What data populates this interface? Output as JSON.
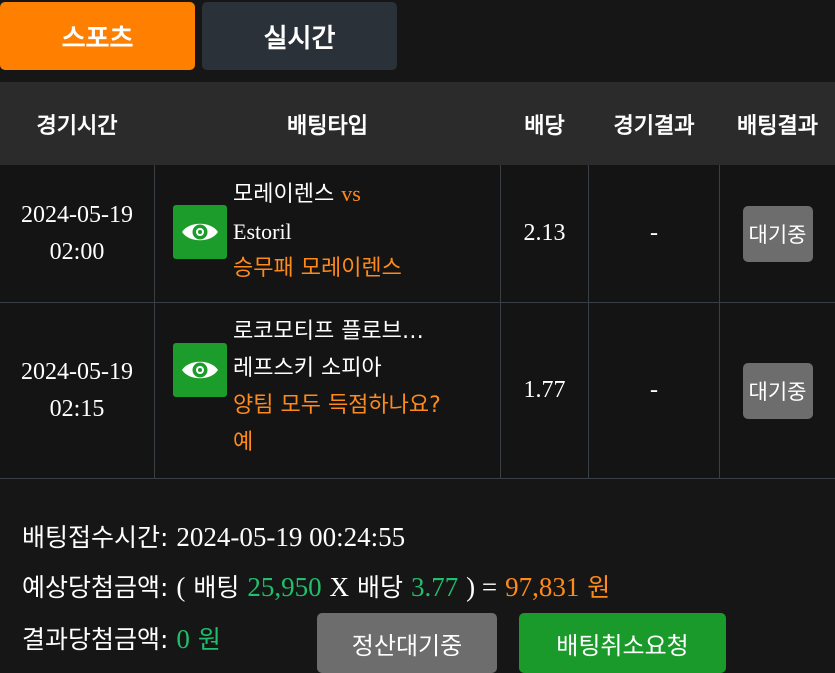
{
  "tabs": {
    "sports": "스포츠",
    "live": "실시간"
  },
  "columns": {
    "time": "경기시간",
    "bet_type": "배팅타입",
    "odds": "배당",
    "match_result": "경기결과",
    "bet_result": "배팅결과"
  },
  "bets": [
    {
      "date": "2024-05-19",
      "time": "02:00",
      "team1": "모레이렌스",
      "vs": "vs",
      "team2": "Estoril",
      "pick": "승무패 모레이렌스",
      "odds": "2.13",
      "result": "-",
      "status": "대기중"
    },
    {
      "date": "2024-05-19",
      "time": "02:15",
      "line1": "로코모티프 플로브…",
      "line2": "레프스키 소피아",
      "pick1": "양팀 모두 득점하나요?",
      "pick2": "예",
      "odds": "1.77",
      "result": "-",
      "status": "대기중"
    }
  ],
  "summary": {
    "received_label": "배팅접수시간:",
    "received_value": "2024-05-19 00:24:55",
    "expected_label": "예상당첨금액:",
    "open_paren": "(",
    "bet_word": "배팅",
    "bet_amount": "25,950",
    "x": "X",
    "odds_word": "배당",
    "total_odds": "3.77",
    "close_eq": ") =",
    "payout": "97,831",
    "won": "원",
    "result_label": "결과당첨금액:",
    "result_amount": "0",
    "result_won": "원"
  },
  "buttons": {
    "pending": "정산대기중",
    "cancel": "배팅취소요청"
  },
  "colors": {
    "orange": "#ff7f00",
    "green": "#1c9c2a",
    "gray": "#6d6d6d"
  }
}
